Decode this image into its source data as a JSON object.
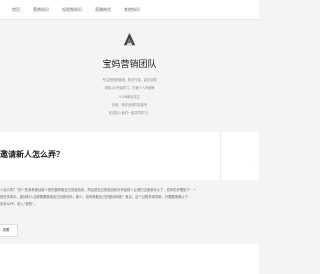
{
  "nav": {
    "items": [
      "首页",
      "营销知识",
      "短视频知识",
      "直播带货",
      "其他知识"
    ]
  },
  "hero": {
    "title": "宝妈营销团队",
    "tagline_lines": [
      "专注短视频营销，知识付费，副业变现",
      "带你从0开始学习，打造个人IP品牌",
      "5.2W粉丝关注",
      "抖音、快手全网同名账号",
      "欢迎加入我们一起共同学习！"
    ]
  },
  "post": {
    "title": "邀请新人怎么弄？",
    "excerpt_lines": [
      "人怎么弄？”的一些参考邀请新人首先要获取自己的邀请码，然后把自己的邀请码分享给别人让他们注册就可以了，具体的步骤如下：一",
      "的好多事中，邀请别人注册需要使用自己的邀请码，那么，如何获取自己的邀请码呢？其实，这个过程非常简单，只需要按照以下",
      "多多从PP，进入“我的”。"
    ],
    "read_more": "查看"
  },
  "colors": {
    "background": "#f4f4f4",
    "card": "#ffffff",
    "title": "#222222",
    "muted": "#888888"
  }
}
